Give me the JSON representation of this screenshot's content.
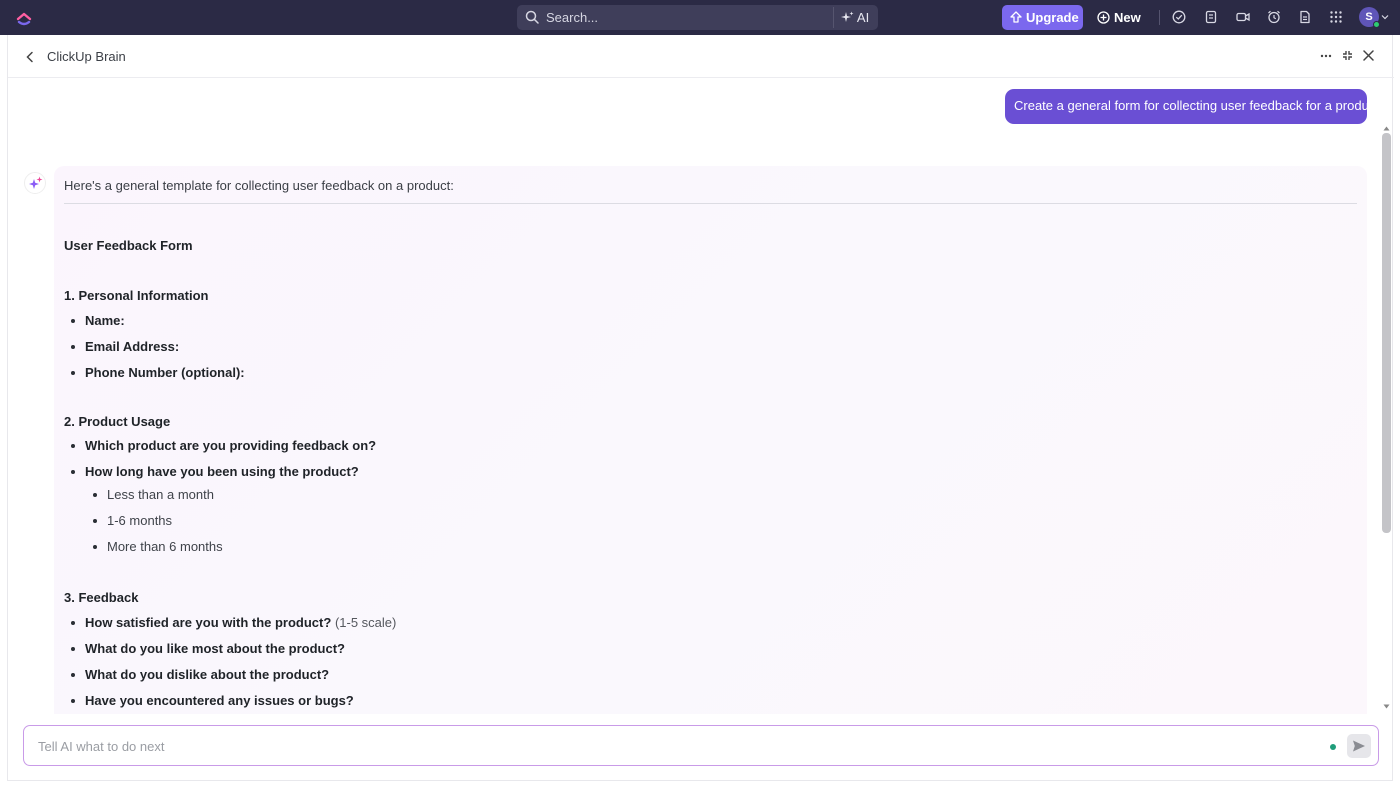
{
  "topbar": {
    "logo_icon": "clickup-logo",
    "search_placeholder": "Search...",
    "ai_label": "AI",
    "upgrade_label": "Upgrade",
    "new_label": "New",
    "avatar_initial": "S",
    "accent_color": "#7b68ee"
  },
  "panel": {
    "title": "ClickUp Brain"
  },
  "chat": {
    "user_message": "Create a general form for collecting user feedback for a product",
    "intro": "Here's a general template for collecting user feedback on a product:",
    "form_title": "User Feedback Form",
    "sections": [
      {
        "heading": "1. Personal Information",
        "items": [
          "Name:",
          "Email Address:",
          "Phone Number (optional):"
        ]
      },
      {
        "heading": "2. Product Usage",
        "items": [
          "Which product are you providing feedback on?",
          "How long have you been using the product?"
        ],
        "subitems": [
          "Less than a month",
          "1-6 months",
          "More than 6 months"
        ]
      },
      {
        "heading": "3. Feedback",
        "items": [
          "How satisfied are you with the product?",
          "What do you like most about the product?",
          "What do you dislike about the product?",
          "Have you encountered any issues or bugs?"
        ],
        "item0_suffix": "(1-5 scale)"
      }
    ]
  },
  "composer": {
    "placeholder": "Tell AI what to do next"
  }
}
